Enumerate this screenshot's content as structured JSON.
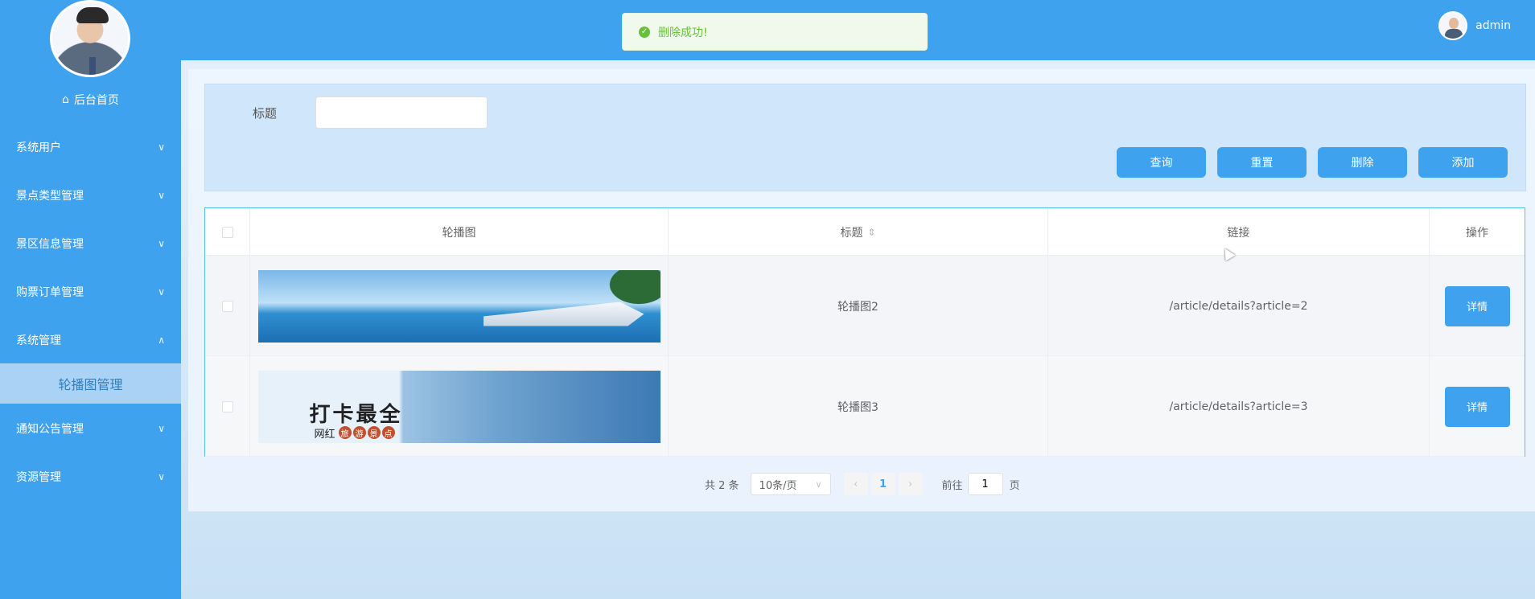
{
  "sidebar": {
    "home_label": "后台首页",
    "items": [
      {
        "label": "系统用户",
        "chevron": "∨"
      },
      {
        "label": "景点类型管理",
        "chevron": "∨"
      },
      {
        "label": "景区信息管理",
        "chevron": "∨"
      },
      {
        "label": "购票订单管理",
        "chevron": "∨"
      },
      {
        "label": "系统管理",
        "chevron": "∧"
      },
      {
        "label": "通知公告管理",
        "chevron": "∨"
      },
      {
        "label": "资源管理",
        "chevron": "∨"
      }
    ],
    "active_sub": "轮播图管理"
  },
  "topbar": {
    "toast": "删除成功!",
    "username": "admin"
  },
  "search": {
    "label": "标题",
    "value": "",
    "buttons": {
      "query": "查询",
      "reset": "重置",
      "delete": "删除",
      "add": "添加"
    }
  },
  "table": {
    "headers": [
      "轮播图",
      "标题",
      "链接",
      "操作"
    ],
    "sort_icon": "⇕",
    "rows": [
      {
        "title": "轮播图2",
        "link": "/article/details?article=2",
        "action": "详情"
      },
      {
        "title": "轮播图3",
        "link": "/article/details?article=3",
        "action": "详情"
      }
    ]
  },
  "banner2": {
    "big_text": "打卡最全",
    "small_prefix": "网红",
    "small_chars": [
      "旅",
      "游",
      "景",
      "点"
    ]
  },
  "pagination": {
    "total": "共 2 条",
    "page_size": "10条/页",
    "current_page": "1",
    "goto_label": "前往",
    "goto_value": "1",
    "goto_unit": "页"
  },
  "colors": {
    "primary": "#3fa2ee",
    "success": "#67c23a"
  }
}
